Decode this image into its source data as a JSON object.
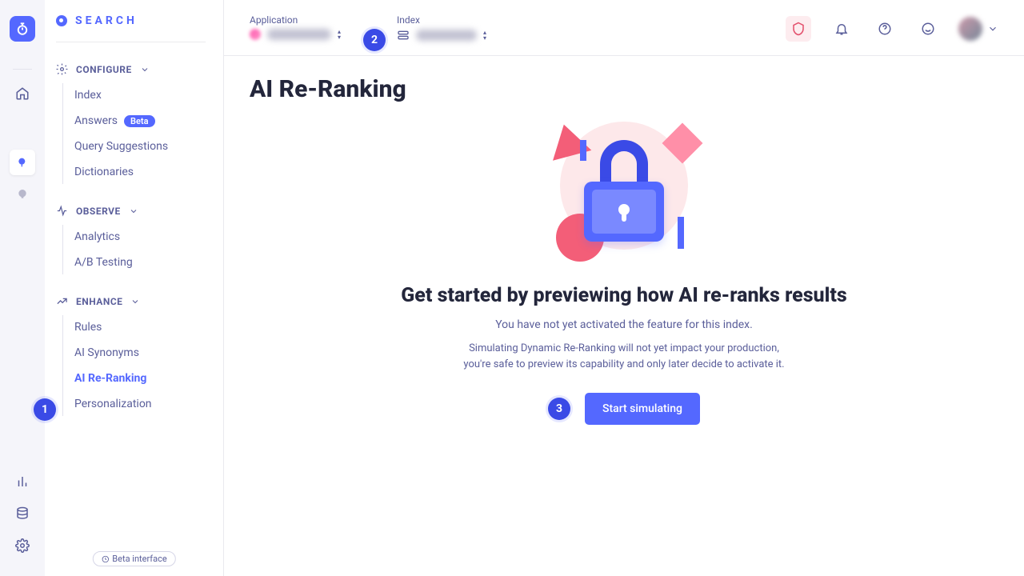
{
  "brand": "SEARCH",
  "steps": {
    "one": "1",
    "two": "2",
    "three": "3"
  },
  "sidebar": {
    "sections": [
      {
        "label": "CONFIGURE",
        "items": [
          {
            "label": "Index"
          },
          {
            "label": "Answers",
            "beta": "Beta"
          },
          {
            "label": "Query Suggestions"
          },
          {
            "label": "Dictionaries"
          }
        ]
      },
      {
        "label": "OBSERVE",
        "items": [
          {
            "label": "Analytics"
          },
          {
            "label": "A/B Testing"
          }
        ]
      },
      {
        "label": "ENHANCE",
        "items": [
          {
            "label": "Rules"
          },
          {
            "label": "AI Synonyms"
          },
          {
            "label": "AI Re-Ranking"
          },
          {
            "label": "Personalization"
          }
        ]
      }
    ],
    "beta_interface": "Beta interface"
  },
  "topbar": {
    "application_label": "Application",
    "index_label": "Index"
  },
  "page": {
    "title": "AI Re-Ranking",
    "heading": "Get started by previewing how AI re-ranks results",
    "subtitle": "You have not yet activated the feature for this index.",
    "desc_l1": "Simulating Dynamic Re-Ranking will not yet impact your production,",
    "desc_l2": "you're safe to preview its capability and only later decide to activate it.",
    "cta": "Start simulating"
  }
}
